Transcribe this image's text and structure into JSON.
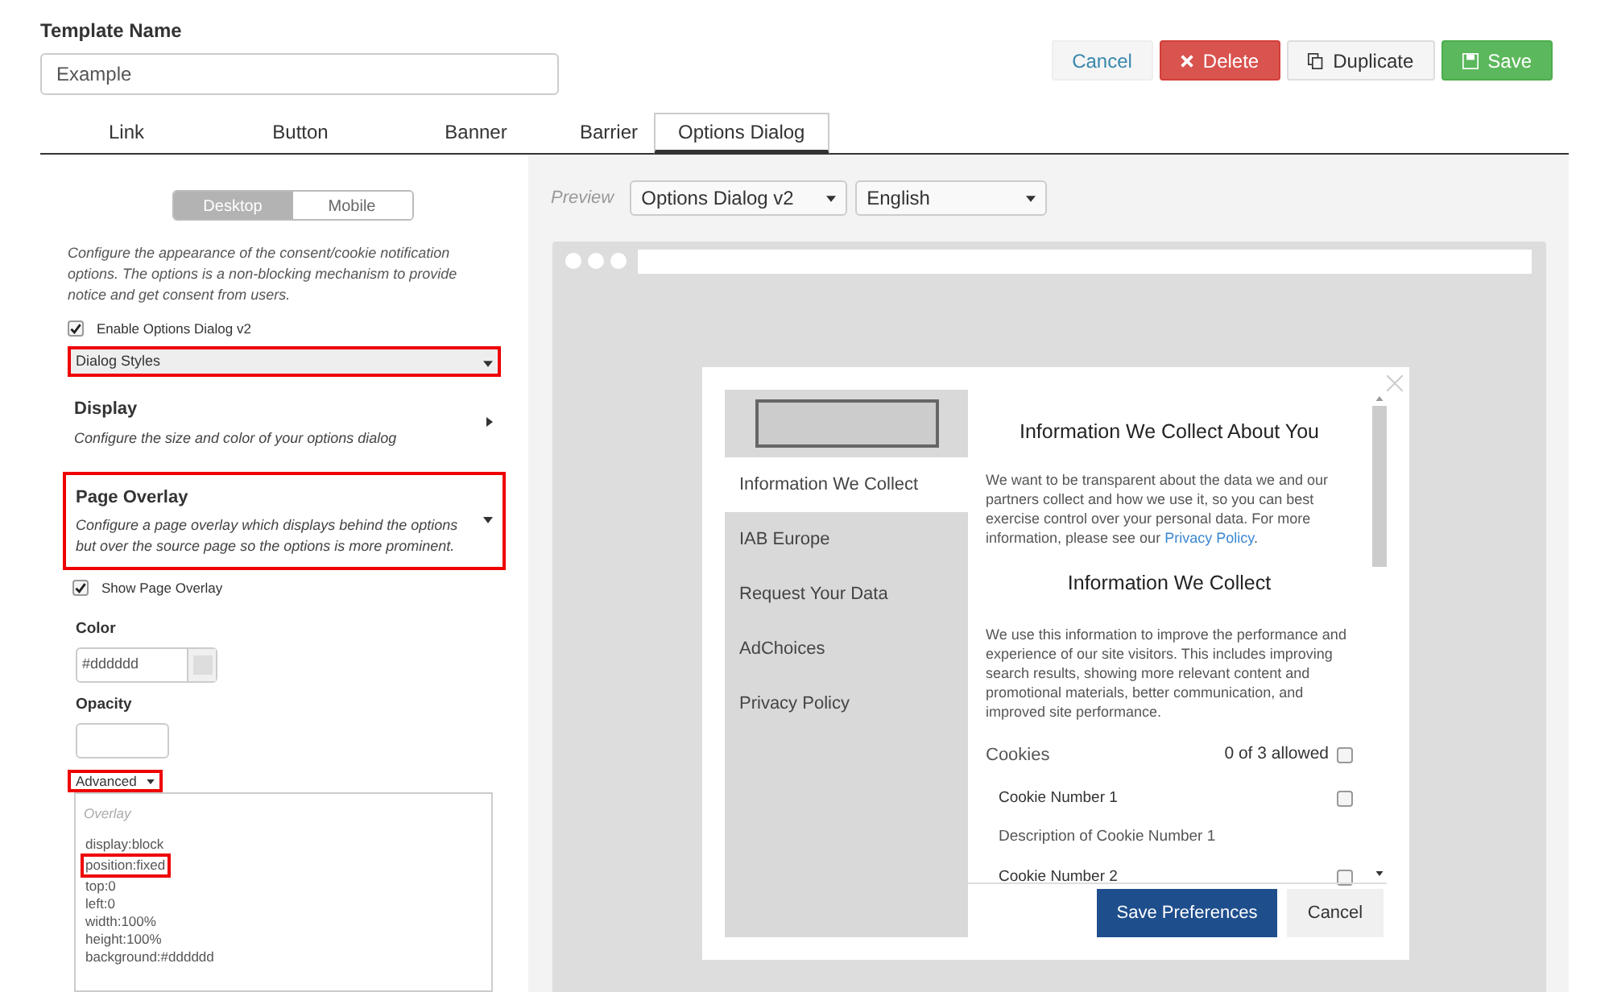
{
  "template_name": {
    "label": "Template Name",
    "value": "Example"
  },
  "actions": [
    {
      "label": "Cancel",
      "kind": "plain"
    },
    {
      "label": "Delete",
      "kind": "danger"
    },
    {
      "label": "Duplicate",
      "kind": "default"
    },
    {
      "label": "Save",
      "kind": "success"
    }
  ],
  "tabs": [
    {
      "label": "Link",
      "selected": false
    },
    {
      "label": "Button",
      "selected": false
    },
    {
      "label": "Banner",
      "selected": false
    },
    {
      "label": "Barrier",
      "selected": false
    },
    {
      "label": "Options Dialog",
      "selected": true
    }
  ],
  "left": {
    "view_toggle": [
      {
        "label": "Desktop",
        "selected": true
      },
      {
        "label": "Mobile",
        "selected": false
      }
    ],
    "intro": "Configure the appearance of the consent/cookie notification options. The options is a non-blocking mechanism to provide notice and get consent from users.",
    "enable": {
      "label": "Enable Options Dialog v2",
      "checked": true
    },
    "style_select": {
      "value": "Dialog Styles",
      "highlighted": true
    },
    "sections": [
      {
        "title": "Display",
        "description": "Configure the size and color of your options dialog",
        "expanded": false,
        "highlighted": false
      },
      {
        "title": "Page Overlay",
        "description": "Configure a page overlay which displays behind the options but over the source page so the options is more prominent.",
        "expanded": true,
        "highlighted": true
      }
    ],
    "show_overlay": {
      "label": "Show Page Overlay",
      "checked": true
    },
    "color": {
      "label": "Color",
      "value": "#dddddd"
    },
    "opacity": {
      "label": "Opacity"
    },
    "advanced": {
      "label": "Advanced",
      "highlighted": true
    },
    "code": {
      "placeholder": "Overlay",
      "lines": [
        {
          "text": "display:block",
          "highlighted": false
        },
        {
          "text": "position:fixed",
          "highlighted": true
        },
        {
          "text": "top:0",
          "highlighted": false
        },
        {
          "text": "left:0",
          "highlighted": false
        },
        {
          "text": "width:100%",
          "highlighted": false
        },
        {
          "text": "height:100%",
          "highlighted": false
        },
        {
          "text": "background:#dddddd",
          "highlighted": false
        }
      ]
    }
  },
  "preview": {
    "label": "Preview",
    "selects": [
      "Options Dialog v2",
      "English"
    ],
    "dialog": {
      "nav": [
        {
          "label": "Information We Collect",
          "selected": true
        },
        {
          "label": "IAB Europe",
          "selected": false
        },
        {
          "label": "Request Your Data",
          "selected": false
        },
        {
          "label": "AdChoices",
          "selected": false
        },
        {
          "label": "Privacy Policy",
          "selected": false
        }
      ],
      "heading": "Information We Collect About You",
      "intro": {
        "before": "We want to be transparent about the data we and our partners collect and how we use it, so you can best exercise control over your personal data. For more information, please see our ",
        "link": "Privacy Policy",
        "after": "."
      },
      "subheading": "Information We Collect",
      "body": "We use this information to improve the performance and experience of our site visitors. This includes improving search results, showing more relevant content and promotional materials, better communication, and improved site performance.",
      "group": {
        "label": "Cookies",
        "count": "0 of 3 allowed",
        "checked": false
      },
      "items": [
        {
          "kind": "cookie",
          "text": "Cookie Number 1",
          "checked": false
        },
        {
          "kind": "description",
          "text": "Description of Cookie Number 1"
        },
        {
          "kind": "cookie",
          "text": "Cookie Number 2",
          "checked": false
        }
      ],
      "buttons": [
        {
          "label": "Save Preferences",
          "kind": "primary"
        },
        {
          "label": "Cancel",
          "kind": "secondary"
        }
      ]
    }
  }
}
